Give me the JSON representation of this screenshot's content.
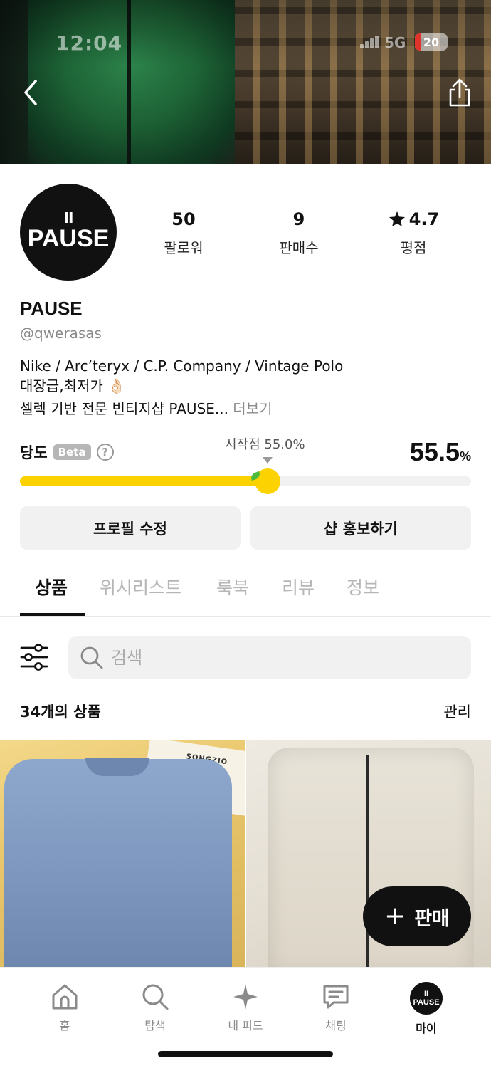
{
  "status_bar": {
    "time": "12:04",
    "network": "5G",
    "battery": "20"
  },
  "header": {
    "back_icon": "chevron-left-icon",
    "share_icon": "share-icon"
  },
  "profile": {
    "avatar_text": "PAUSE",
    "avatar_mark": "II",
    "stats": [
      {
        "value": "50",
        "label": "팔로워"
      },
      {
        "value": "9",
        "label": "판매수"
      },
      {
        "value": "4.7",
        "label": "평점",
        "icon": "star-icon"
      }
    ],
    "name": "PAUSE",
    "handle": "@qwerasas",
    "bio_line1": "Nike / Arc’teryx / C.P. Company / Vintage Polo",
    "bio_line2": "대장급,최저가 👌🏻",
    "bio_line3": "셀렉 기반 전문 빈티지샵 PAUSE...",
    "bio_more": "더보기"
  },
  "freshness": {
    "label": "당도",
    "badge": "Beta",
    "help": "?",
    "start_label": "시작점 55.0%",
    "value": "55.5",
    "unit": "%",
    "level_percent": 55.5,
    "start_percent": 55.0,
    "colors": {
      "fill": "#fcd200",
      "track": "#f1f1f1"
    }
  },
  "actions": {
    "edit_profile": "프로필 수정",
    "promote_shop": "샵 홍보하기"
  },
  "tabs": [
    "상품",
    "위시리스트",
    "룩북",
    "리뷰",
    "정보"
  ],
  "search": {
    "placeholder": "검색",
    "value": ""
  },
  "products": {
    "count_label": "34개의 상품",
    "manage_label": "관리",
    "card_label": "SONGZIO"
  },
  "sell_button": {
    "label": "판매",
    "icon": "plus-icon"
  },
  "bottom_nav": [
    {
      "label": "홈",
      "icon": "home-icon"
    },
    {
      "label": "탐색",
      "icon": "search-icon"
    },
    {
      "label": "내 피드",
      "icon": "sparkle-icon"
    },
    {
      "label": "채팅",
      "icon": "chat-icon"
    },
    {
      "label": "마이",
      "icon": "profile-avatar",
      "active": true
    }
  ],
  "theme": {
    "accent": "#fcd200",
    "text": "#111111",
    "muted": "#8a8a8a"
  }
}
